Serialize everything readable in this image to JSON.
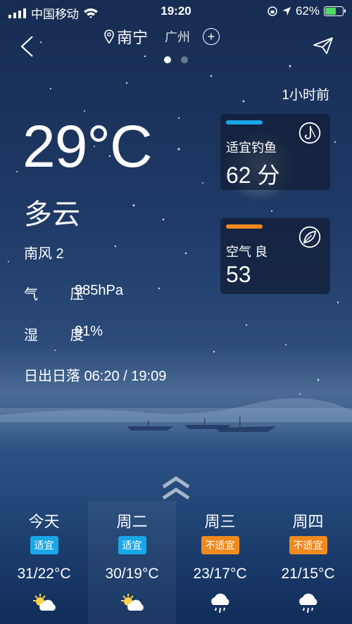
{
  "status": {
    "carrier": "中国移动",
    "time": "19:20",
    "battery_text": "62%",
    "battery_level": 0.62,
    "colors": {
      "battery_fill": "#4cd964"
    }
  },
  "nav": {
    "current_city": "南宁",
    "other_city": "广州",
    "add_symbol": "+",
    "page_count": 2,
    "active_page": 1
  },
  "weather": {
    "updated": "1小时前",
    "temperature": "29°C",
    "condition": "多云",
    "wind": "南风 2",
    "pressure_label": "气 压",
    "pressure_value": "985hPa",
    "humidity_label": "湿 度",
    "humidity_value": "91%",
    "sun_label": "日出日落",
    "sun_value": "06:20 / 19:09"
  },
  "cards": {
    "fishing": {
      "label": "适宜钓鱼",
      "value": "62 分",
      "accent": "#1aa7e8",
      "icon": "fishing-hook-icon"
    },
    "air": {
      "label": "空气 良",
      "value": "53",
      "accent": "#f08a1e",
      "icon": "leaf-icon"
    }
  },
  "forecast": [
    {
      "day": "今天",
      "badge": "适宜",
      "badge_color": "#1aa7e8",
      "range": "31/22°C",
      "icon": "partly-cloudy-icon"
    },
    {
      "day": "周二",
      "badge": "适宜",
      "badge_color": "#1aa7e8",
      "range": "30/19°C",
      "icon": "partly-cloudy-icon"
    },
    {
      "day": "周三",
      "badge": "不适宜",
      "badge_color": "#f08a1e",
      "range": "23/17°C",
      "icon": "rain-icon"
    },
    {
      "day": "周四",
      "badge": "不适宜",
      "badge_color": "#f08a1e",
      "range": "21/15°C",
      "icon": "rain-icon"
    }
  ]
}
